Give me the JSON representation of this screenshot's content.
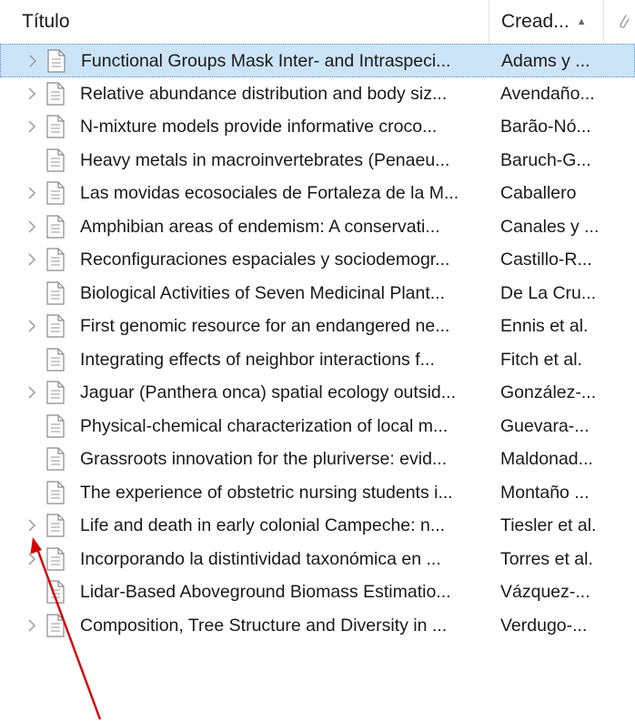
{
  "columns": {
    "title": "Título",
    "creator": "Cread...",
    "sort_indicator": "▲",
    "attachment_icon": "paperclip-icon"
  },
  "rows": [
    {
      "title": "Functional Groups Mask Inter- and Intraspeci...",
      "creator": "Adams y ...",
      "expandable": true,
      "selected": true
    },
    {
      "title": "Relative abundance distribution and body siz...",
      "creator": "Avendaño...",
      "expandable": true
    },
    {
      "title": "N-mixture models provide informative croco...",
      "creator": "Barão-Nó...",
      "expandable": true
    },
    {
      "title": "Heavy metals in macroinvertebrates (Penaeu...",
      "creator": "Baruch-G...",
      "expandable": false
    },
    {
      "title": "Las movidas ecosociales de Fortaleza de la M...",
      "creator": "Caballero",
      "expandable": true
    },
    {
      "title": "Amphibian areas of endemism: A conservati...",
      "creator": "Canales y ...",
      "expandable": true
    },
    {
      "title": "Reconfiguraciones espaciales y sociodemogr...",
      "creator": "Castillo-R...",
      "expandable": true
    },
    {
      "title": "Biological Activities of Seven Medicinal Plant...",
      "creator": "De La Cru...",
      "expandable": false
    },
    {
      "title": "First genomic resource for an endangered ne...",
      "creator": "Ennis et al.",
      "expandable": true
    },
    {
      "title": "Integrating effects of neighbor interactions f...",
      "creator": "Fitch et al.",
      "expandable": false
    },
    {
      "title": "Jaguar (Panthera onca) spatial ecology outsid...",
      "creator": "González-...",
      "expandable": true
    },
    {
      "title": "Physical-chemical characterization of local m...",
      "creator": "Guevara-...",
      "expandable": false
    },
    {
      "title": "Grassroots innovation for the pluriverse: evid...",
      "creator": "Maldonad...",
      "expandable": false
    },
    {
      "title": "The experience of obstetric nursing students i...",
      "creator": "Montaño ...",
      "expandable": false
    },
    {
      "title": "Life and death in early colonial Campeche: n...",
      "creator": "Tiesler et al.",
      "expandable": true
    },
    {
      "title": "Incorporando la distintividad taxonómica en ...",
      "creator": "Torres et al.",
      "expandable": true
    },
    {
      "title": "Lidar-Based Aboveground Biomass Estimatio...",
      "creator": "Vázquez-...",
      "expandable": false
    },
    {
      "title": "Composition, Tree Structure and Diversity in ...",
      "creator": "Verdugo-...",
      "expandable": true
    }
  ],
  "colors": {
    "selected_row": "#cce4f7",
    "selected_border": "#5b8fd6",
    "annotation_arrow": "#d40000",
    "twisty": "#9a9a9a"
  }
}
